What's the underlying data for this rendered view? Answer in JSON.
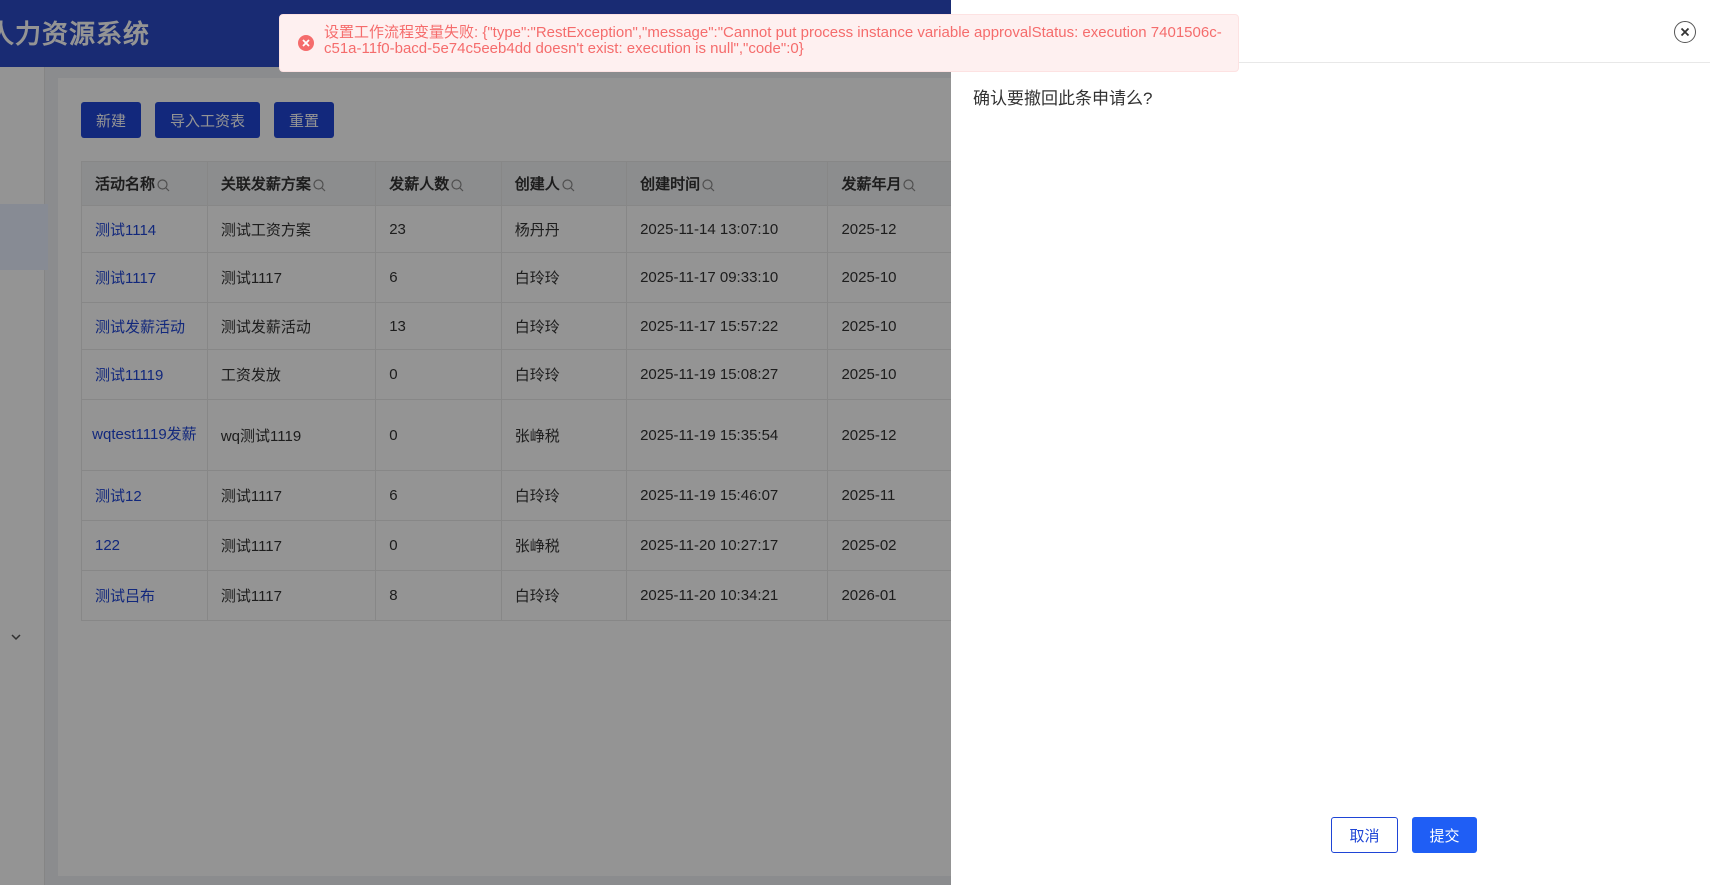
{
  "app": {
    "title": "人力资源系统",
    "brand_color": "#2b4ac6",
    "accent_color": "#1f45d6"
  },
  "toolbar": {
    "new_label": "新建",
    "import_label": "导入工资表",
    "reset_label": "重置"
  },
  "table": {
    "columns": [
      "活动名称",
      "关联发薪方案",
      "发薪人数",
      "创建人",
      "创建时间",
      "发薪年月"
    ],
    "rows": [
      [
        "测试1114",
        "测试工资方案",
        "23",
        "杨丹丹",
        "2025-11-14 13:07:10",
        "2025-12"
      ],
      [
        "测试1117",
        "测试1117",
        "6",
        "白玲玲",
        "2025-11-17 09:33:10",
        "2025-10"
      ],
      [
        "测试发薪活动",
        "测试发薪活动",
        "13",
        "白玲玲",
        "2025-11-17 15:57:22",
        "2025-10"
      ],
      [
        "测试11119",
        "工资发放",
        "0",
        "白玲玲",
        "2025-11-19 15:08:27",
        "2025-10"
      ],
      [
        "wqtest1119发薪",
        "wq测试1119",
        "0",
        "张峥税",
        "2025-11-19 15:35:54",
        "2025-12"
      ],
      [
        "测试12",
        "测试1117",
        "6",
        "白玲玲",
        "2025-11-19 15:46:07",
        "2025-11"
      ],
      [
        "122",
        "测试1117",
        "0",
        "张峥税",
        "2025-11-20 10:27:17",
        "2025-02"
      ],
      [
        "测试吕布",
        "测试1117",
        "8",
        "白玲玲",
        "2025-11-20 10:34:21",
        "2026-01"
      ]
    ]
  },
  "toast": {
    "type": "error",
    "message": "设置工作流程变量失败: {\"type\":\"RestException\",\"message\":\"Cannot put process instance variable approvalStatus: execution 7401506c-c51a-11f0-bacd-5e74c5eeb4dd doesn't exist: execution is null\",\"code\":0}",
    "color": "#f56c6c"
  },
  "drawer": {
    "message": "确认要撤回此条申请么?",
    "cancel_label": "取消",
    "submit_label": "提交"
  }
}
